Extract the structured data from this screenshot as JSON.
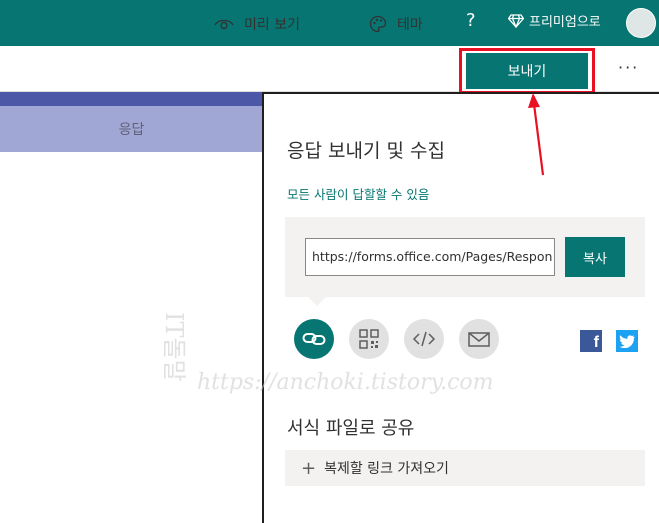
{
  "topbar": {
    "help_label": "?",
    "premium_label": "프리미엄으로",
    "bg_color": "#077572"
  },
  "toolbar": {
    "preview_label": "미리 보기",
    "theme_label": "테마",
    "send_label": "보내기",
    "more_label": "···"
  },
  "left": {
    "responses_tab_label": "응답"
  },
  "send_panel": {
    "title": "응답 보내기 및 수집",
    "audience_label": "모든 사람이 답할할 수 있음",
    "link_value": "https://forms.office.com/Pages/Respon",
    "copy_label": "복사",
    "share_options": [
      "link-icon",
      "qr-code-icon",
      "embed-code-icon",
      "email-icon"
    ],
    "social": [
      "facebook-icon",
      "twitter-icon"
    ],
    "template_title": "서식 파일로 공유",
    "template_link_label": "복제할 링크 가져오기"
  },
  "watermark": {
    "line1": "IT돌말",
    "line2": "https://anchoki.tistory.com"
  },
  "colors": {
    "accent": "#077572",
    "highlight": "#e81123",
    "purple_bar": "#4d57a8",
    "tab_bg": "#a1a7d4"
  }
}
